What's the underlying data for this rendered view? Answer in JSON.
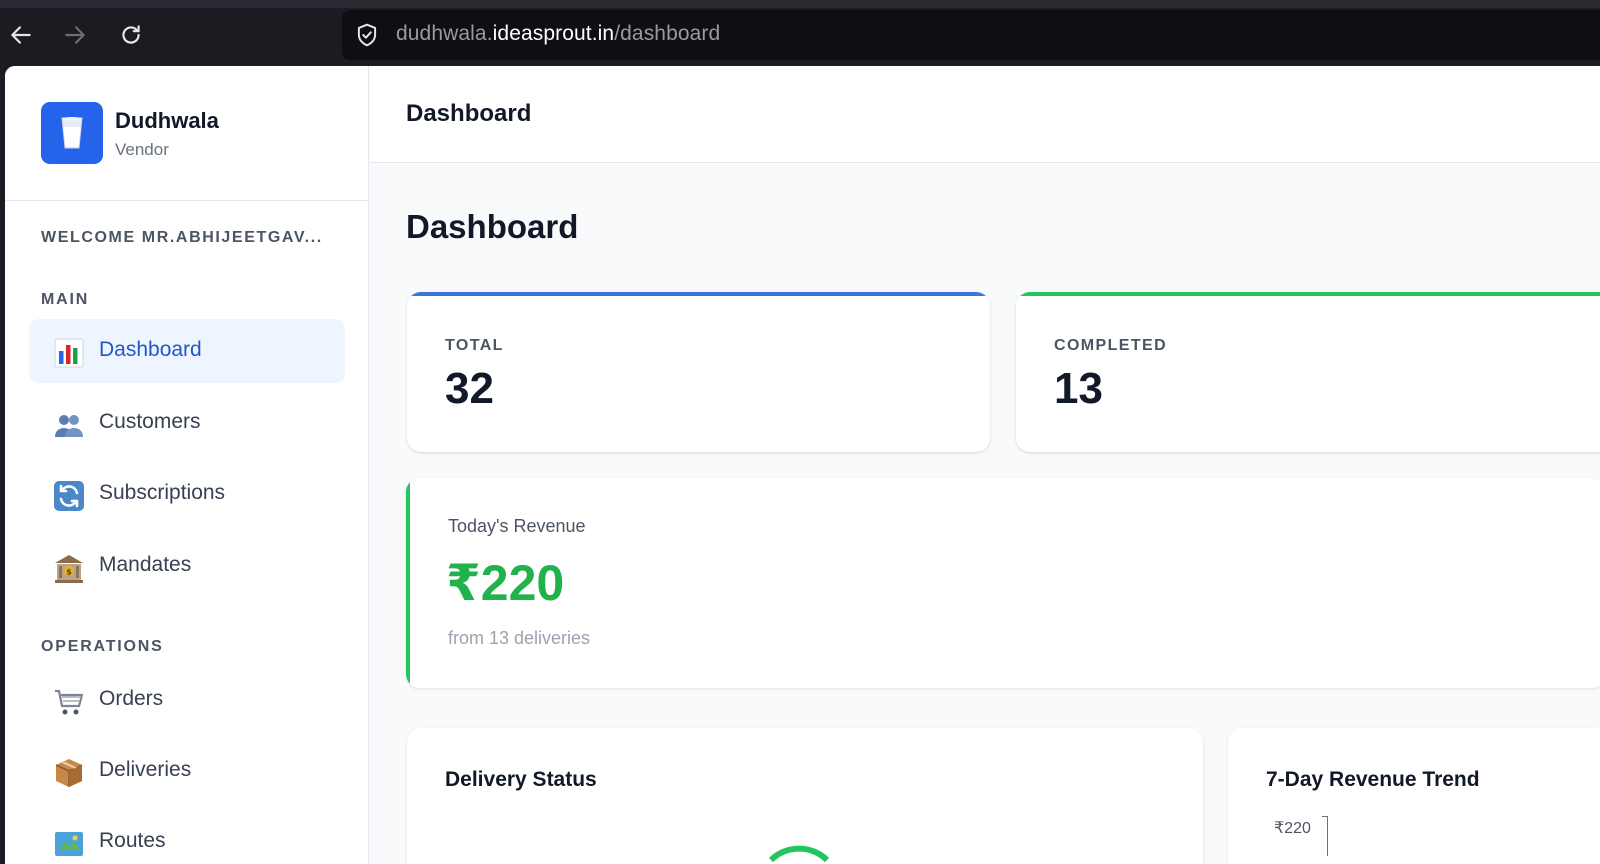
{
  "browser": {
    "url_prefix": "dudhwala.",
    "url_domain": "ideasprout.in",
    "url_path": "/dashboard"
  },
  "sidebar": {
    "brand_name": "Dudhwala",
    "brand_sub": "Vendor",
    "welcome": "WELCOME MR.ABHIJEETGAV...",
    "sections": [
      {
        "label": "MAIN",
        "items": [
          {
            "label": "Dashboard",
            "icon": "bar-chart-icon",
            "active": true
          },
          {
            "label": "Customers",
            "icon": "users-icon"
          },
          {
            "label": "Subscriptions",
            "icon": "refresh-icon"
          },
          {
            "label": "Mandates",
            "icon": "bank-icon"
          }
        ]
      },
      {
        "label": "OPERATIONS",
        "items": [
          {
            "label": "Orders",
            "icon": "cart-icon"
          },
          {
            "label": "Deliveries",
            "icon": "package-icon"
          },
          {
            "label": "Routes",
            "icon": "map-icon"
          }
        ]
      }
    ]
  },
  "topbar": {
    "title": "Dashboard"
  },
  "page": {
    "title": "Dashboard",
    "stats": [
      {
        "label": "TOTAL",
        "value": "32",
        "accent": "#3b74db"
      },
      {
        "label": "COMPLETED",
        "value": "13",
        "accent": "#22c55e"
      }
    ],
    "revenue": {
      "label": "Today's Revenue",
      "value": "₹220",
      "sub": "from 13 deliveries",
      "accent": "#22c55e"
    },
    "panels": {
      "delivery_status": {
        "title": "Delivery Status"
      },
      "revenue_trend": {
        "title": "7-Day Revenue Trend",
        "tick_top": "₹220"
      }
    }
  }
}
